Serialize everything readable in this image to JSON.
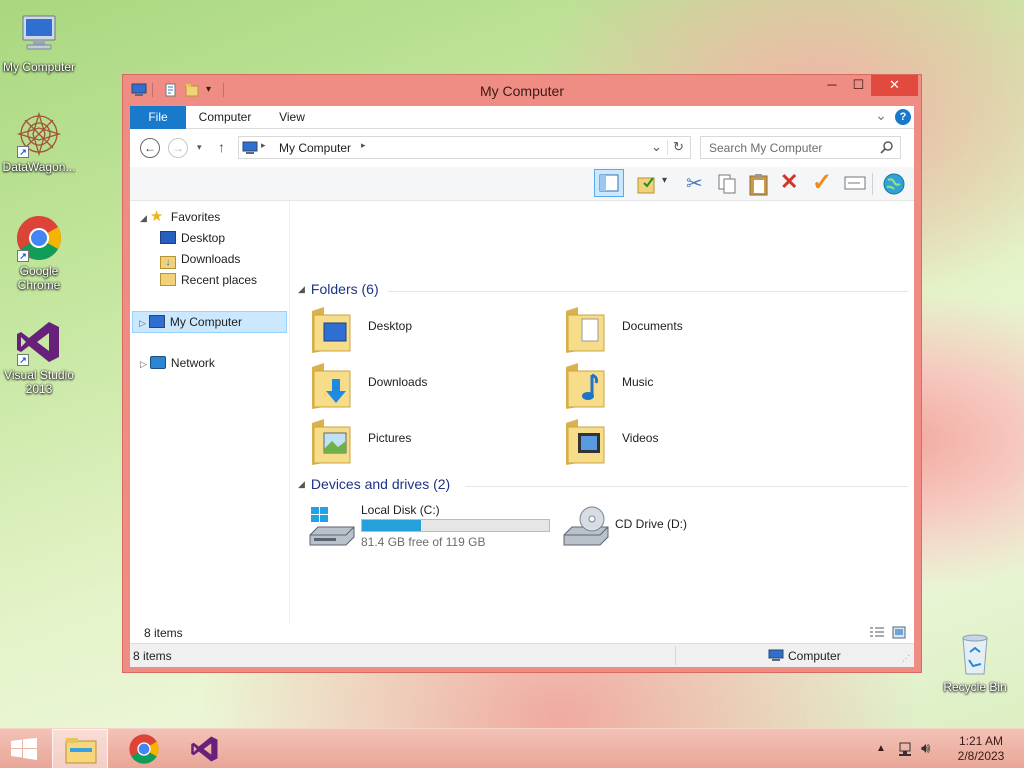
{
  "desktop": {
    "icons": [
      {
        "label": "My Computer",
        "icon": "computer-icon"
      },
      {
        "label": "DataWagon...",
        "icon": "datawagon-icon"
      },
      {
        "label": "Google Chrome",
        "icon": "chrome-icon"
      },
      {
        "label": "Visual Studio 2013",
        "icon": "visual-studio-icon"
      },
      {
        "label": "Recycle Bin",
        "icon": "recycle-bin-icon"
      }
    ]
  },
  "window": {
    "title": "My Computer",
    "controls": {
      "minimize": "─",
      "maximize": "☐",
      "close": "✕"
    }
  },
  "ribbon": {
    "tabs": [
      {
        "label": "File",
        "active": true
      },
      {
        "label": "Computer"
      },
      {
        "label": "View"
      }
    ],
    "collapse_glyph": "⌄",
    "help_glyph": "?"
  },
  "address": {
    "path": "My Computer",
    "search_placeholder": "Search My Computer"
  },
  "nav": {
    "favorites_label": "Favorites",
    "favorites": [
      "Desktop",
      "Downloads",
      "Recent places"
    ],
    "computer_label": "My Computer",
    "network_label": "Network"
  },
  "folders": {
    "header": "Folders (6)",
    "items": [
      "Desktop",
      "Documents",
      "Downloads",
      "Music",
      "Pictures",
      "Videos"
    ]
  },
  "drives": {
    "header": "Devices and drives (2)",
    "items": [
      {
        "name": "Local Disk (C:)",
        "free_text": "81.4 GB free of 119 GB",
        "used_fraction": 0.316
      },
      {
        "name": "CD Drive (D:)"
      }
    ]
  },
  "status": {
    "inner_count": "8 items",
    "count": "8 items",
    "location": "Computer"
  },
  "taskbar": {
    "time": "1:21 AM",
    "date": "2/8/2023"
  },
  "colors": {
    "accent": "#1979ca",
    "window_frame": "#ef8c83",
    "progress": "#26a0da",
    "selection": "#cce8ff"
  }
}
